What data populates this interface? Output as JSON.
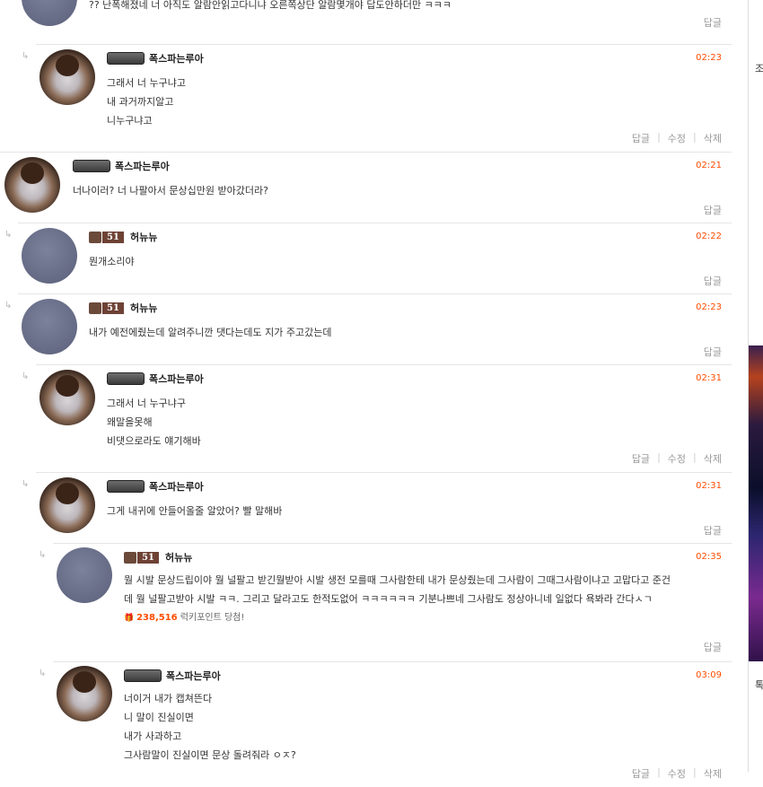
{
  "comments": [
    {
      "avatar": "blue",
      "indent": 0,
      "badge": "",
      "nick": "",
      "time": "",
      "lines": [
        "?? 난폭해졌네 너 아직도 알람안읽고다니냐 오른쪽상단 알람몇개야 답도안하더만 ㅋㅋㅋ"
      ],
      "actions": [
        "답글"
      ]
    },
    {
      "avatar": "photo",
      "indent": 2,
      "badge": "gear",
      "nick": "폭스파는루아",
      "time": "02:23",
      "lines": [
        "그래서 너 누구냐고",
        "내 과거까지알고",
        "니누구냐고"
      ],
      "actions": [
        "답글",
        "수정",
        "삭제"
      ]
    },
    {
      "avatar": "photo",
      "indent": 0,
      "badge": "gear",
      "nick": "폭스파는루아",
      "time": "02:21",
      "lines": [
        "너나이러? 너 나팔아서 문상십만원 받아갔더라?"
      ],
      "actions": [
        "답글"
      ]
    },
    {
      "avatar": "blue",
      "indent": 1,
      "badge": "lvl",
      "level": "51",
      "nick": "허뉴뉴",
      "time": "02:22",
      "lines": [
        "뭔개소리야"
      ],
      "actions": [
        "답글"
      ]
    },
    {
      "avatar": "blue",
      "indent": 1,
      "badge": "lvl",
      "level": "51",
      "nick": "허뉴뉴",
      "time": "02:23",
      "lines": [
        "내가 예전에줬는데 알려주니깐 댓다는데도 지가 주고갔는데"
      ],
      "actions": [
        "답글"
      ]
    },
    {
      "avatar": "photo",
      "indent": 2,
      "badge": "gear",
      "nick": "폭스파는루아",
      "time": "02:31",
      "lines": [
        "그래서 너 누구냐구",
        "왜말을못해",
        "비댓으로라도 얘기해바"
      ],
      "actions": [
        "답글",
        "수정",
        "삭제"
      ]
    },
    {
      "avatar": "photo",
      "indent": 2,
      "badge": "gear",
      "nick": "폭스파는루아",
      "time": "02:31",
      "lines": [
        "그게 내귀에 안들어올줄 알았어? 빨 말해바"
      ],
      "actions": [
        "답글"
      ]
    },
    {
      "avatar": "blue",
      "indent": 3,
      "badge": "lvl",
      "level": "51",
      "nick": "허뉴뉴",
      "time": "02:35",
      "lines": [
        "뭘 시발 문상드립이야 뭘 널팔고 받긴뭘받아 시발 생전 모를때 그사람한테 내가 문상줬는데 그사람이 그때그사람이냐고 고맙다고 준건",
        "데  뭘 널팔고받아 시발 ㅋㅋ. 그리고 달라고도 한적도없어 ㅋㅋㅋㅋㅋㅋ 기분나쁘네 그사람도 정상아니네 일없다 욕봐라 간다ㅅㄱ"
      ],
      "lucky": {
        "icon": "gift-icon",
        "points": "238,516",
        "text": "럭키포인트 당첨!"
      },
      "actions": [
        "답글"
      ]
    },
    {
      "avatar": "photo",
      "indent": 3,
      "badge": "gear",
      "nick": "폭스파는루아",
      "time": "03:09",
      "lines": [
        "너이거 내가 캡쳐뜬다",
        "니 말이 진실이면",
        "내가 사과하고",
        "그사람말이 진실이면 문상 돌려줘라 ㅇㅈ?"
      ],
      "actions": [
        "답글",
        "수정",
        "삭제"
      ]
    }
  ],
  "sidebar": {
    "char_a": "조",
    "char_b": "톡"
  }
}
